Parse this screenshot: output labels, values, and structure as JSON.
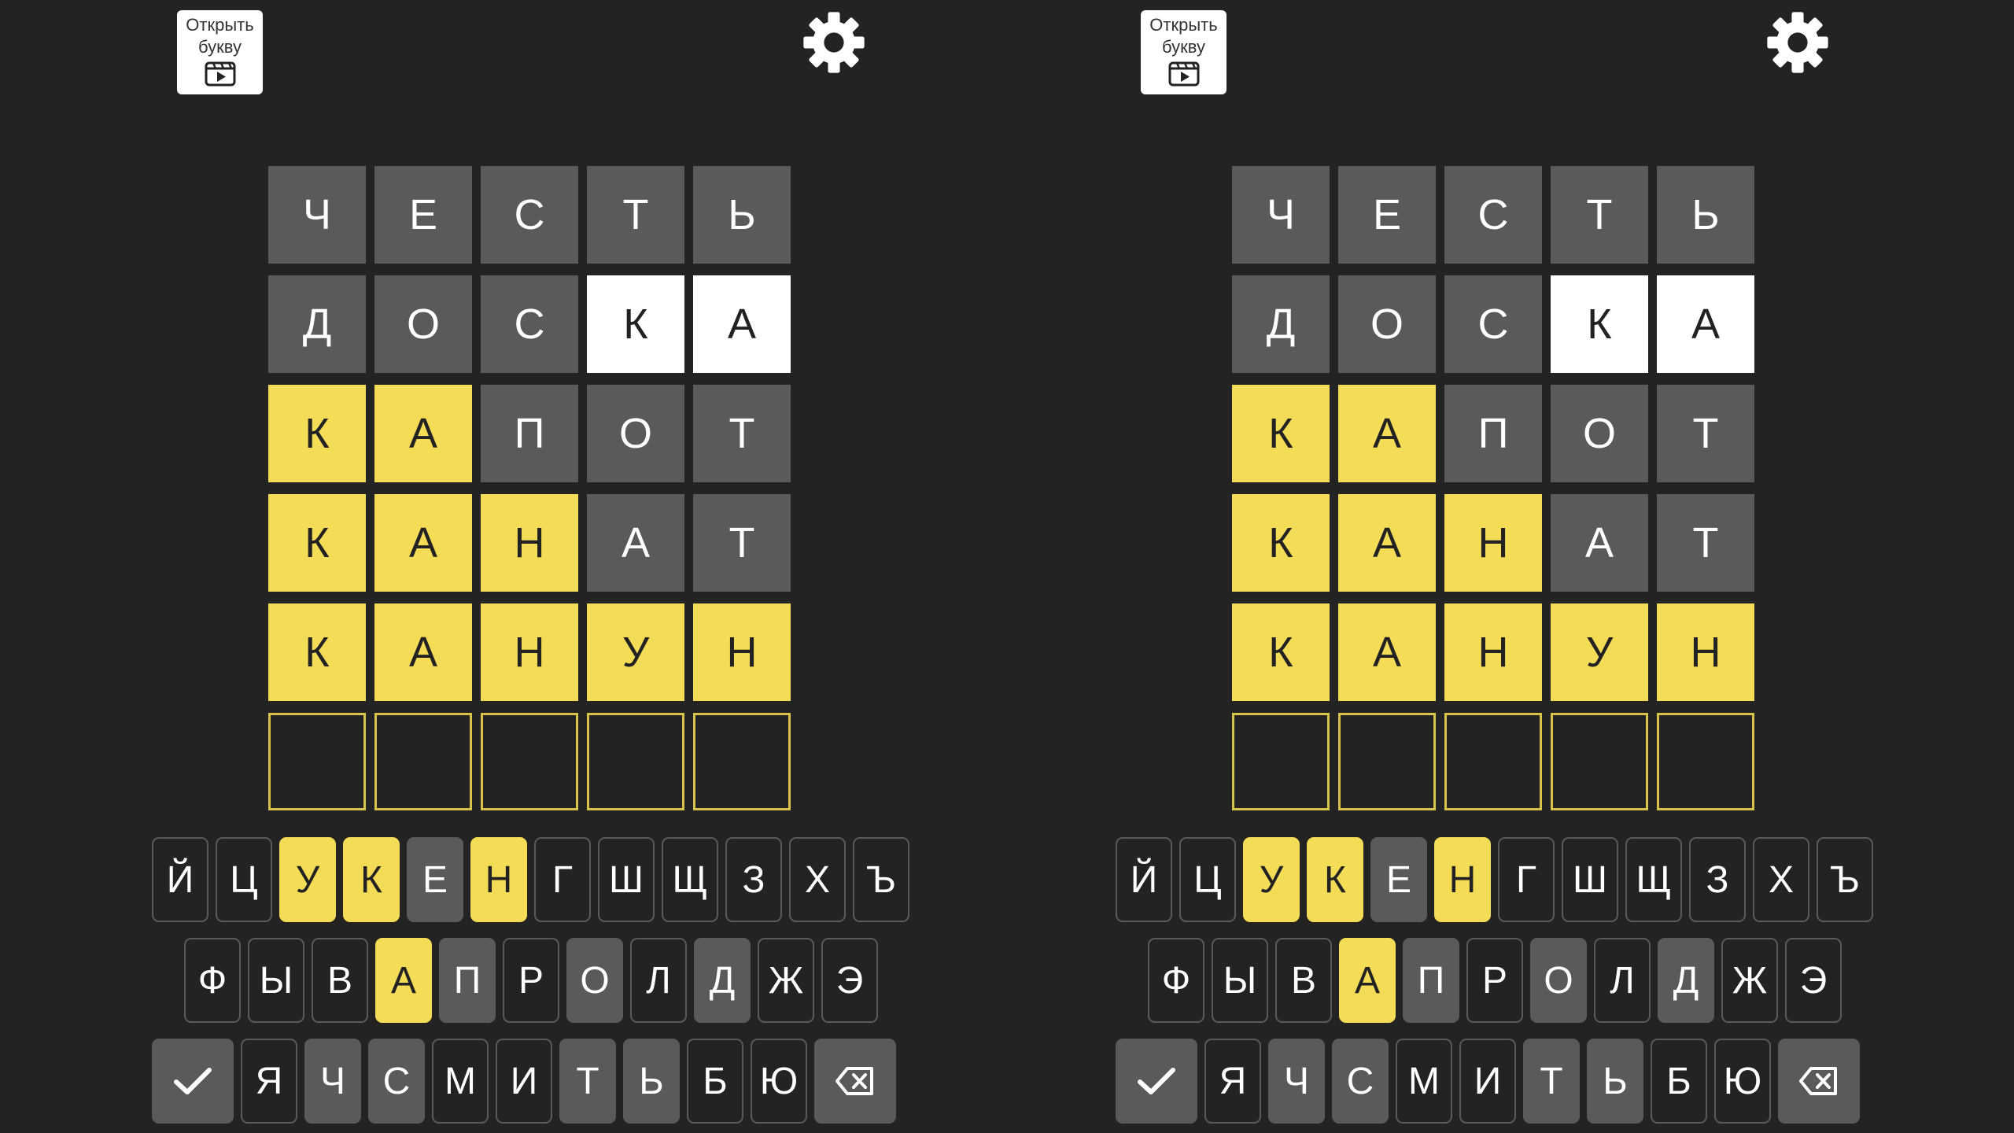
{
  "hint_button": {
    "label": "Открыть букву",
    "icon": "video-play-icon"
  },
  "settings": {
    "icon": "gear-icon"
  },
  "colors": {
    "background": "#232323",
    "gray": "#5a5a5a",
    "yellow": "#f5dc56",
    "white": "#ffffff",
    "empty_border": "#d9c44b"
  },
  "board": [
    [
      {
        "letter": "Ч",
        "state": "gray"
      },
      {
        "letter": "Е",
        "state": "gray"
      },
      {
        "letter": "С",
        "state": "gray"
      },
      {
        "letter": "Т",
        "state": "gray"
      },
      {
        "letter": "Ь",
        "state": "gray"
      }
    ],
    [
      {
        "letter": "Д",
        "state": "gray"
      },
      {
        "letter": "О",
        "state": "gray"
      },
      {
        "letter": "С",
        "state": "gray"
      },
      {
        "letter": "К",
        "state": "white"
      },
      {
        "letter": "А",
        "state": "white"
      }
    ],
    [
      {
        "letter": "К",
        "state": "yellow"
      },
      {
        "letter": "А",
        "state": "yellow"
      },
      {
        "letter": "П",
        "state": "gray"
      },
      {
        "letter": "О",
        "state": "gray"
      },
      {
        "letter": "Т",
        "state": "gray"
      }
    ],
    [
      {
        "letter": "К",
        "state": "yellow"
      },
      {
        "letter": "А",
        "state": "yellow"
      },
      {
        "letter": "Н",
        "state": "yellow"
      },
      {
        "letter": "А",
        "state": "gray"
      },
      {
        "letter": "Т",
        "state": "gray"
      }
    ],
    [
      {
        "letter": "К",
        "state": "yellow"
      },
      {
        "letter": "А",
        "state": "yellow"
      },
      {
        "letter": "Н",
        "state": "yellow"
      },
      {
        "letter": "У",
        "state": "yellow"
      },
      {
        "letter": "Н",
        "state": "yellow"
      }
    ],
    [
      {
        "letter": "",
        "state": "empty"
      },
      {
        "letter": "",
        "state": "empty"
      },
      {
        "letter": "",
        "state": "empty"
      },
      {
        "letter": "",
        "state": "empty"
      },
      {
        "letter": "",
        "state": "empty"
      }
    ]
  ],
  "keyboard": {
    "row1": [
      {
        "label": "Й",
        "state": "default"
      },
      {
        "label": "Ц",
        "state": "default"
      },
      {
        "label": "У",
        "state": "yellow"
      },
      {
        "label": "К",
        "state": "yellow"
      },
      {
        "label": "Е",
        "state": "gray"
      },
      {
        "label": "Н",
        "state": "yellow"
      },
      {
        "label": "Г",
        "state": "default"
      },
      {
        "label": "Ш",
        "state": "default"
      },
      {
        "label": "Щ",
        "state": "default"
      },
      {
        "label": "З",
        "state": "default"
      },
      {
        "label": "Х",
        "state": "default"
      },
      {
        "label": "Ъ",
        "state": "default"
      }
    ],
    "row2": [
      {
        "label": "Ф",
        "state": "default"
      },
      {
        "label": "Ы",
        "state": "default"
      },
      {
        "label": "В",
        "state": "default"
      },
      {
        "label": "А",
        "state": "yellow"
      },
      {
        "label": "П",
        "state": "gray"
      },
      {
        "label": "Р",
        "state": "default"
      },
      {
        "label": "О",
        "state": "gray"
      },
      {
        "label": "Л",
        "state": "default"
      },
      {
        "label": "Д",
        "state": "gray"
      },
      {
        "label": "Ж",
        "state": "default"
      },
      {
        "label": "Э",
        "state": "default"
      }
    ],
    "row3": [
      {
        "label": "Я",
        "state": "default"
      },
      {
        "label": "Ч",
        "state": "gray"
      },
      {
        "label": "С",
        "state": "gray"
      },
      {
        "label": "М",
        "state": "default"
      },
      {
        "label": "И",
        "state": "default"
      },
      {
        "label": "Т",
        "state": "gray"
      },
      {
        "label": "Ь",
        "state": "gray"
      },
      {
        "label": "Б",
        "state": "default"
      },
      {
        "label": "Ю",
        "state": "default"
      }
    ],
    "submit_icon": "checkmark-icon",
    "backspace_icon": "backspace-icon"
  }
}
